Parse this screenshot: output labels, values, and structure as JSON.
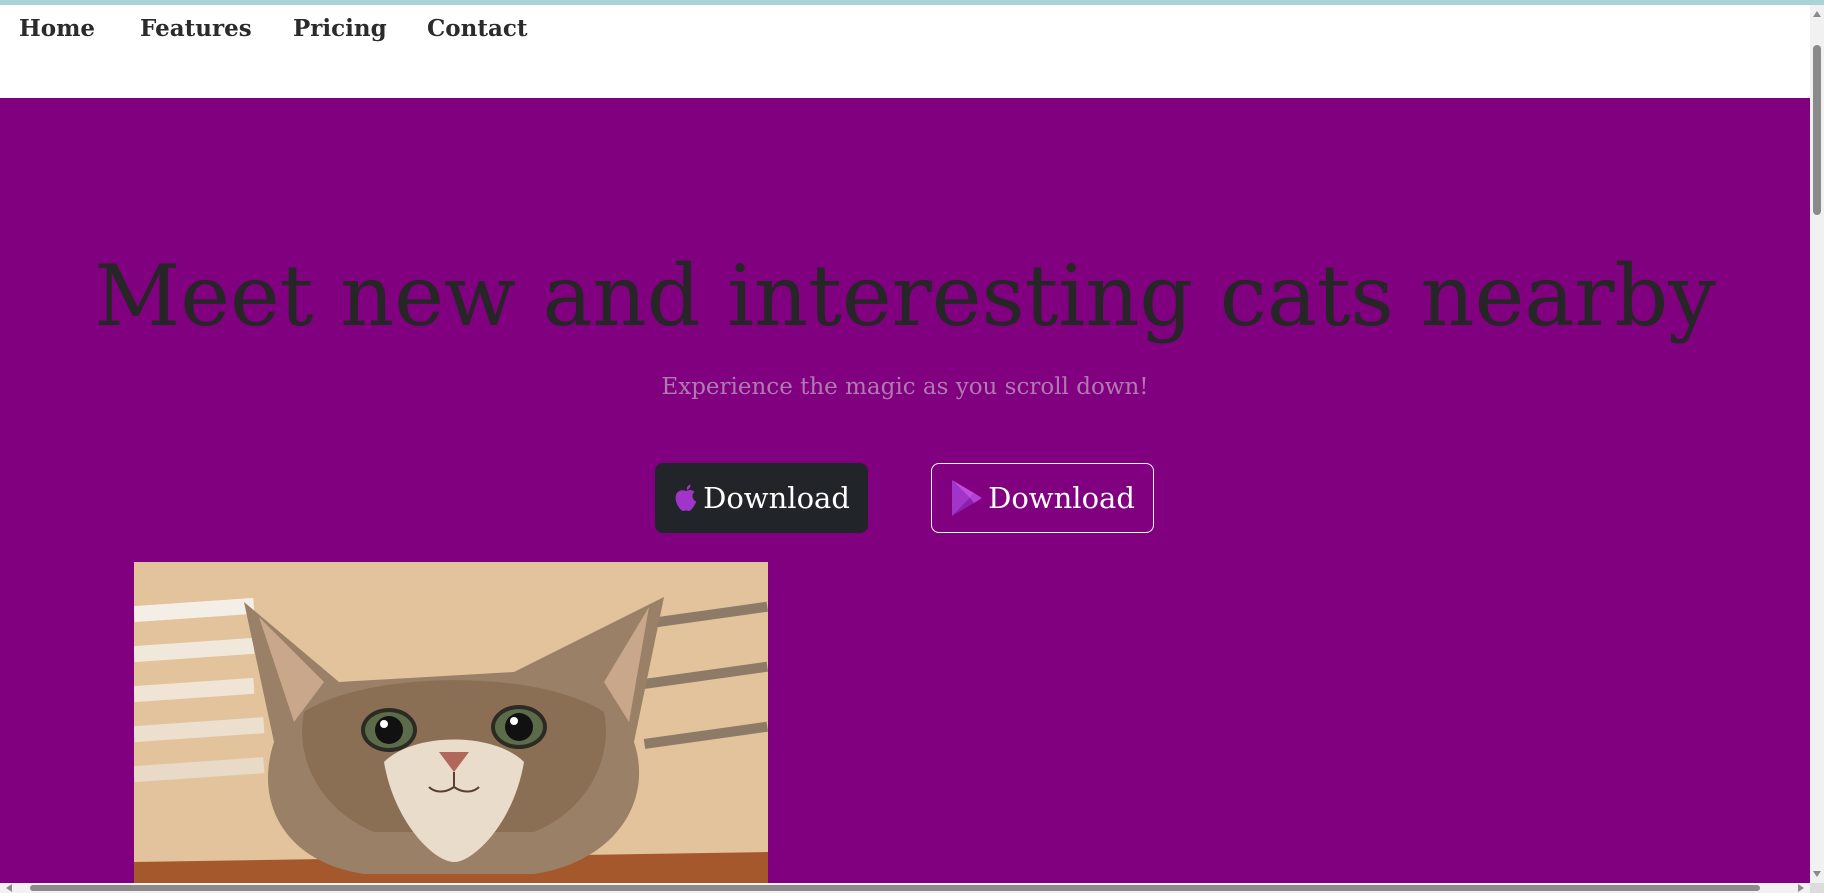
{
  "nav": {
    "items": [
      {
        "label": "Home"
      },
      {
        "label": "Features"
      },
      {
        "label": "Pricing"
      },
      {
        "label": "Contact"
      }
    ]
  },
  "hero": {
    "title": "Meet new and interesting cats nearby",
    "subtitle": "Experience the magic as you scroll down!",
    "buttons": [
      {
        "label": "Download",
        "icon": "apple-icon"
      },
      {
        "label": "Download",
        "icon": "google-play-icon"
      }
    ],
    "image": {
      "icon": "cat-photo"
    }
  },
  "colors": {
    "hero_background": "#800080",
    "title_text": "#262626",
    "subtitle_text": "#b07ab0",
    "apple_button_background": "#212529",
    "icon_purple": "#a235c9",
    "top_accent": "#a9d3d6"
  }
}
